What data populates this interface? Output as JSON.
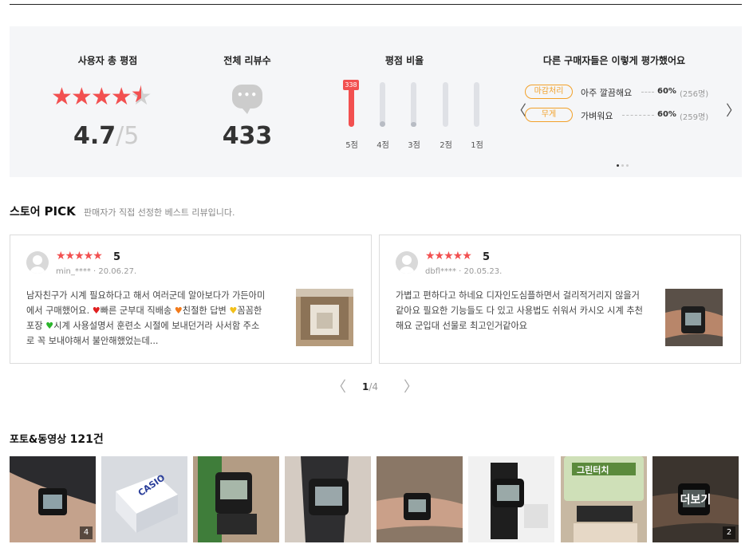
{
  "summary": {
    "rating_title": "사용자 총 평점",
    "rating_value": "4.7",
    "rating_slash": "/",
    "rating_max": "5",
    "rating_stars": 4.7,
    "count_title": "전체 리뷰수",
    "count_value": "433",
    "ratio_title": "평점 비율",
    "ratio_bars": [
      {
        "label": "5점",
        "percent": 100,
        "badge": "338",
        "color": "#f25050"
      },
      {
        "label": "4점",
        "percent": 12,
        "color": "#b8bcc4"
      },
      {
        "label": "3점",
        "percent": 10,
        "color": "#b8bcc4"
      },
      {
        "label": "2점",
        "percent": 0,
        "color": "#b8bcc4"
      },
      {
        "label": "1점",
        "percent": 0,
        "color": "#b8bcc4"
      }
    ],
    "others_title": "다른 구매자들은 이렇게 평가했어요",
    "evaluations": [
      {
        "tag": "마감처리",
        "text": "아주 깔끔해요",
        "pct": "60%",
        "count": "(256명)"
      },
      {
        "tag": "무게",
        "text": "가벼워요",
        "pct": "60%",
        "count": "(259명)"
      }
    ]
  },
  "store_pick": {
    "title_prefix": "스토어",
    "title_bold": "PICK",
    "description": "판매자가 직접 선정한 베스트 리뷰입니다.",
    "reviews": [
      {
        "stars": "★★★★★",
        "score": "5",
        "user": "min_****",
        "date": "20.06.27.",
        "body_parts": [
          "남자친구가 시계 필요하다고 해서 여러군데 알아보다가 가든아미에서 구매했어요. ",
          "빠른 군부대 직배송 ",
          "친절한 답변 ",
          "꼼꼼한 포장 ",
          "시계 사용설명서 훈련소 시절에 보내던거라 사서함 주소로 꼭 보내야해서 불안해했었는데..."
        ]
      },
      {
        "stars": "★★★★★",
        "score": "5",
        "user": "dbfl****",
        "date": "20.05.23.",
        "body": "가볍고 편하다고 하네요 디자인도심플하면서 걸리적거리지 않을거같아요 필요한 기능들도 다 있고 사용법도 쉬워서 카시오 시계 추천해요 군입대 선물로 최고인거같아요"
      }
    ],
    "pager": {
      "current": "1",
      "slash": "/",
      "total": "4"
    }
  },
  "photos": {
    "title": "포토&동영상",
    "count": "121건",
    "thumbs": [
      {
        "badge": "4"
      },
      {
        "logo_text": "CASIO"
      },
      {},
      {},
      {},
      {},
      {
        "brand_text": "그린터치"
      },
      {
        "more": "더보기",
        "badge": "2"
      }
    ]
  },
  "icons": {
    "star": "star-icon",
    "speech_bubble": "speech-bubble-icon",
    "prev": "chevron-left-icon",
    "next": "chevron-right-icon"
  },
  "colors": {
    "accent_red": "#f25050",
    "tag_orange": "#f2a12a",
    "panel_bg": "#f5f6f8"
  }
}
